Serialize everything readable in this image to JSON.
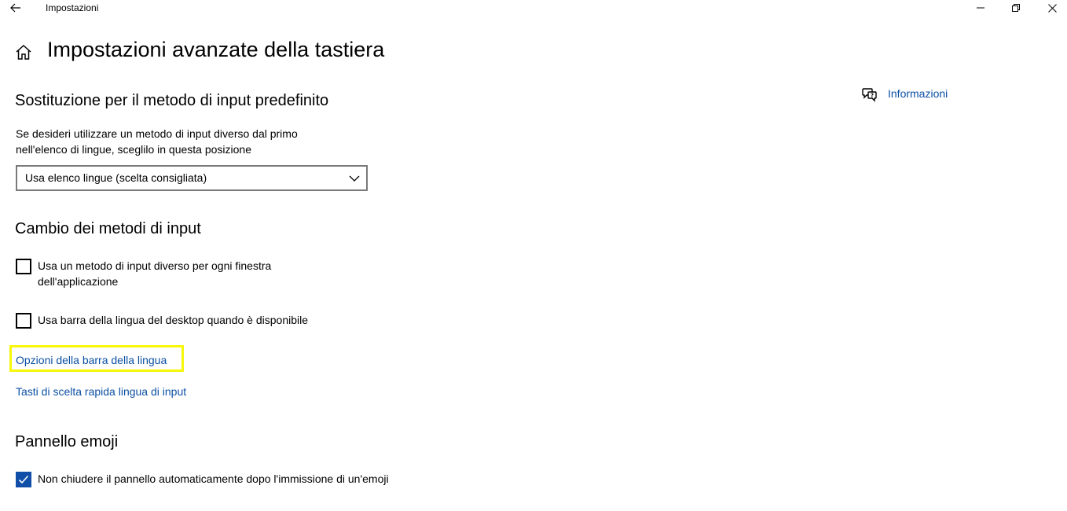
{
  "window": {
    "app_title": "Impostazioni",
    "back_icon": "back-arrow-icon",
    "minimize_icon": "minimize-icon",
    "restore_icon": "restore-icon",
    "close_icon": "close-icon"
  },
  "header": {
    "home_icon": "home-icon",
    "title": "Impostazioni avanzate della tastiera"
  },
  "sections": {
    "input_override": {
      "title": "Sostituzione per il metodo di input predefinito",
      "description_line1": "Se desideri utilizzare un metodo di input diverso dal primo",
      "description_line2": "nell'elenco di lingue, sceglilo in questa posizione",
      "dropdown_value": "Usa elenco lingue (scelta consigliata)"
    },
    "switching": {
      "title": "Cambio dei metodi di input",
      "checkbox1_line1": "Usa un metodo di input diverso per ogni finestra",
      "checkbox1_line2": "dell'applicazione",
      "checkbox1_checked": false,
      "checkbox2_label": "Usa barra della lingua del desktop quando è disponibile",
      "checkbox2_checked": false,
      "link_language_bar": "Opzioni della barra della lingua",
      "link_hotkeys": "Tasti di scelta rapida lingua di input"
    },
    "emoji": {
      "title": "Pannello emoji",
      "checkbox_label": "Non chiudere il pannello automaticamente dopo l'immissione di un'emoji",
      "checkbox_checked": true
    }
  },
  "sidebar": {
    "info_icon": "chat-help-icon",
    "info_label": "Informazioni"
  },
  "colors": {
    "accent": "#0f4fa8",
    "link": "#0b4fa3",
    "highlight": "#f7f70a"
  }
}
